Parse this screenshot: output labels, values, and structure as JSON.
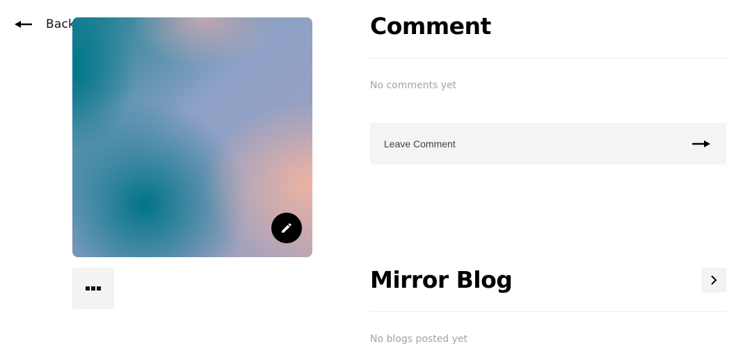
{
  "back": {
    "label": "Back",
    "icon": "arrow-left-icon"
  },
  "artwork": {
    "edit_icon": "pencil-icon",
    "colors": {
      "teal": "#00748a",
      "lavender": "#96a0c4",
      "peach": "#f2b4a0"
    }
  },
  "more_button": {
    "icon": "ellipsis-icon"
  },
  "comments": {
    "title": "Comment",
    "empty_text": "No comments yet",
    "input_placeholder": "Leave Comment",
    "input_value": "",
    "send_icon": "arrow-right-icon"
  },
  "blog": {
    "title": "Mirror Blog",
    "empty_text": "No blogs posted yet",
    "chevron_icon": "chevron-right-icon"
  }
}
